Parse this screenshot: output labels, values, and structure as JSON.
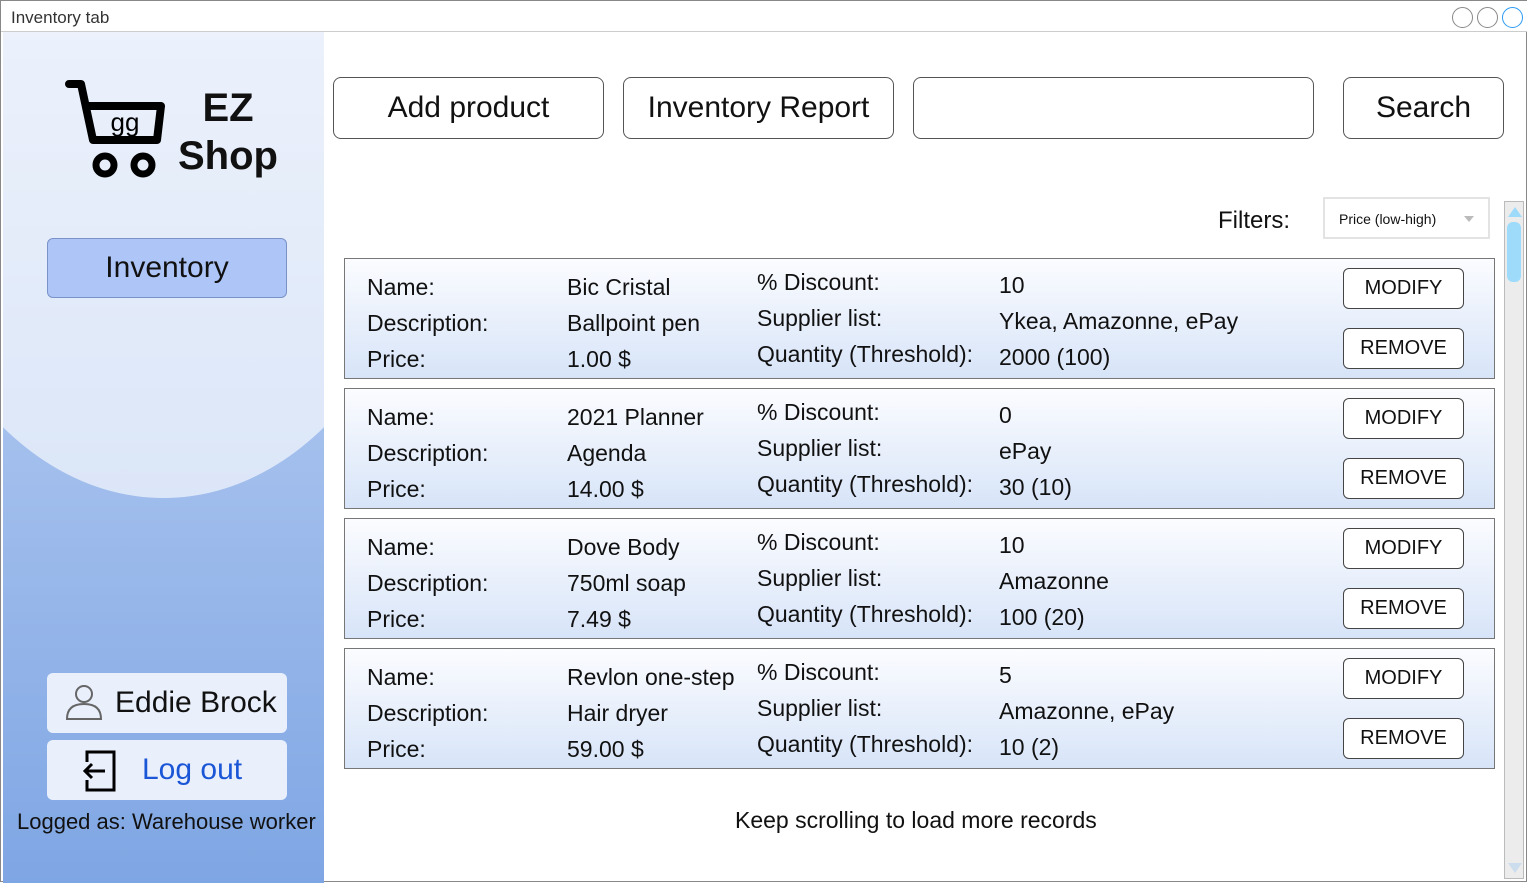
{
  "window": {
    "title": "Inventory tab"
  },
  "brand": {
    "logo_text": "gg",
    "name_line1": "EZ",
    "name_line2": "Shop"
  },
  "sidebar": {
    "nav_inventory": "Inventory",
    "user_name": "Eddie Brock",
    "logout": "Log out",
    "logged_as": "Logged as: Warehouse worker"
  },
  "toolbar": {
    "add_product": "Add product",
    "inventory_report": "Inventory Report",
    "search_value": "",
    "search": "Search"
  },
  "filters": {
    "label": "Filters:",
    "selected": "Price (low-high)"
  },
  "labels": {
    "name": "Name:",
    "description": "Description:",
    "price": "Price:",
    "discount": "% Discount:",
    "suppliers": "Supplier list:",
    "quantity": "Quantity (Threshold):",
    "modify": "MODIFY",
    "remove": "REMOVE"
  },
  "products": [
    {
      "name": "Bic Cristal",
      "description": "Ballpoint pen",
      "price": "1.00 $",
      "discount": "10",
      "suppliers": "Ykea, Amazonne, ePay",
      "quantity": "2000 (100)"
    },
    {
      "name": "2021 Planner",
      "description": "Agenda",
      "price": "14.00 $",
      "discount": "0",
      "suppliers": "ePay",
      "quantity": "30 (10)"
    },
    {
      "name": "Dove Body",
      "description": "750ml soap",
      "price": "7.49 $",
      "discount": "10",
      "suppliers": "Amazonne",
      "quantity": "100 (20)"
    },
    {
      "name": "Revlon one-step",
      "description": "Hair dryer",
      "price": "59.00 $",
      "discount": "5",
      "suppliers": "Amazonne, ePay",
      "quantity": "10 (2)"
    }
  ],
  "footer": {
    "more": "Keep scrolling to load more records"
  }
}
